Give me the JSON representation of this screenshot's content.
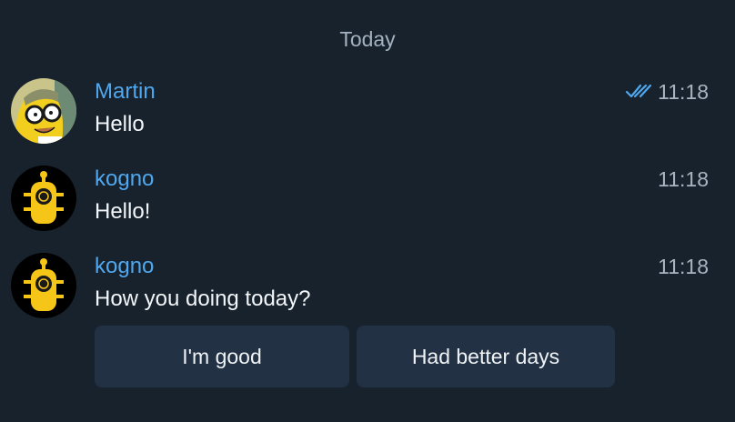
{
  "date_separator": "Today",
  "messages": [
    {
      "sender": "Martin",
      "text": "Hello",
      "time": "11:18",
      "read": true,
      "avatar": "simpson-avatar"
    },
    {
      "sender": "kogno",
      "text": "Hello!",
      "time": "11:18",
      "avatar": "robot-avatar"
    },
    {
      "sender": "kogno",
      "text": "How you doing today?",
      "time": "11:18",
      "avatar": "robot-avatar"
    }
  ],
  "keyboard": {
    "buttons": [
      "I'm good",
      "Had better days"
    ]
  },
  "colors": {
    "background": "#18222d",
    "sender_name": "#4fa8ef",
    "button_bg": "#223144",
    "read_check": "#4fa8ef"
  }
}
